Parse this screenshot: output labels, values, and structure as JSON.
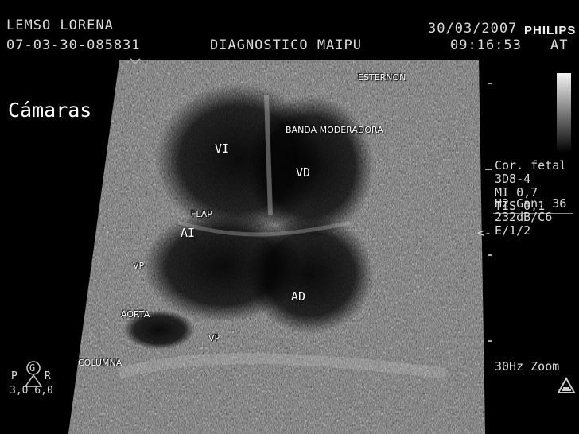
{
  "header": {
    "patient_name": "LEMSO LORENA",
    "study_id": "07-03-30-085831",
    "institution": "DIAGNOSTICO MAIPU",
    "date": "30/03/2007",
    "time": "09:16:53",
    "brand_line1": "PHILIPS",
    "brand_line2": "AT"
  },
  "title": "Cámaras",
  "labels": {
    "esternon": "ESTERNON",
    "banda": "BANDA MODERADORA",
    "vi": "VI",
    "vd": "VD",
    "flap": "FLAP",
    "ai": "AI",
    "vp_left": "VP",
    "ad": "AD",
    "aorta": "AORTA",
    "vp_bottom": "VP",
    "columna": "COLUMNA"
  },
  "settings": {
    "line1": "Cor. fetal",
    "line2": "3D8-4",
    "line3": "MI 0,7",
    "line4": "TIS 0,1",
    "line5": "H2 Gan. 36",
    "line6": "232dB/C6",
    "line7": "E/1/2",
    "frame": "30Hz Zoom"
  },
  "orientation": {
    "p": "P",
    "g": "G",
    "r": "R",
    "scale": "3,0 6,0"
  },
  "pointer": "<-"
}
